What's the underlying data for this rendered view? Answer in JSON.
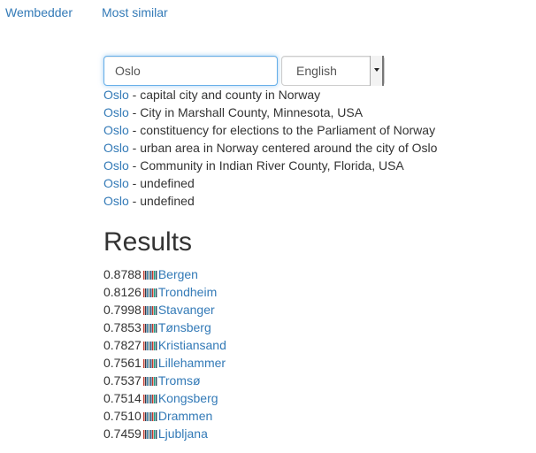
{
  "nav": [
    "Wembedder",
    "Most similar"
  ],
  "search": {
    "value": "Oslo",
    "language": "English"
  },
  "suggestions": [
    {
      "term": "Oslo",
      "description": " - capital city and county in Norway"
    },
    {
      "term": "Oslo",
      "description": " - City in Marshall County, Minnesota, USA"
    },
    {
      "term": "Oslo",
      "description": " - constituency for elections to the Parliament of Norway"
    },
    {
      "term": "Oslo",
      "description": " - urban area in Norway centered around the city of Oslo"
    },
    {
      "term": "Oslo",
      "description": " - Community in Indian River County, Florida, USA"
    },
    {
      "term": "Oslo",
      "description": " - undefined"
    },
    {
      "term": "Oslo",
      "description": " - undefined"
    }
  ],
  "results_title": "Results",
  "results": [
    {
      "score": "0.8788",
      "name": "Bergen"
    },
    {
      "score": "0.8126",
      "name": "Trondheim"
    },
    {
      "score": "0.7998",
      "name": "Stavanger"
    },
    {
      "score": "0.7853",
      "name": "Tønsberg"
    },
    {
      "score": "0.7827",
      "name": "Kristiansand"
    },
    {
      "score": "0.7561",
      "name": "Lillehammer"
    },
    {
      "score": "0.7537",
      "name": "Tromsø"
    },
    {
      "score": "0.7514",
      "name": "Kongsberg"
    },
    {
      "score": "0.7510",
      "name": "Drammen"
    },
    {
      "score": "0.7459",
      "name": "Ljubljana"
    }
  ],
  "colors": {
    "link": "#337ab7",
    "text": "#333333",
    "focus": "#66afe9"
  },
  "icons": {
    "result": "barcode-icon"
  }
}
